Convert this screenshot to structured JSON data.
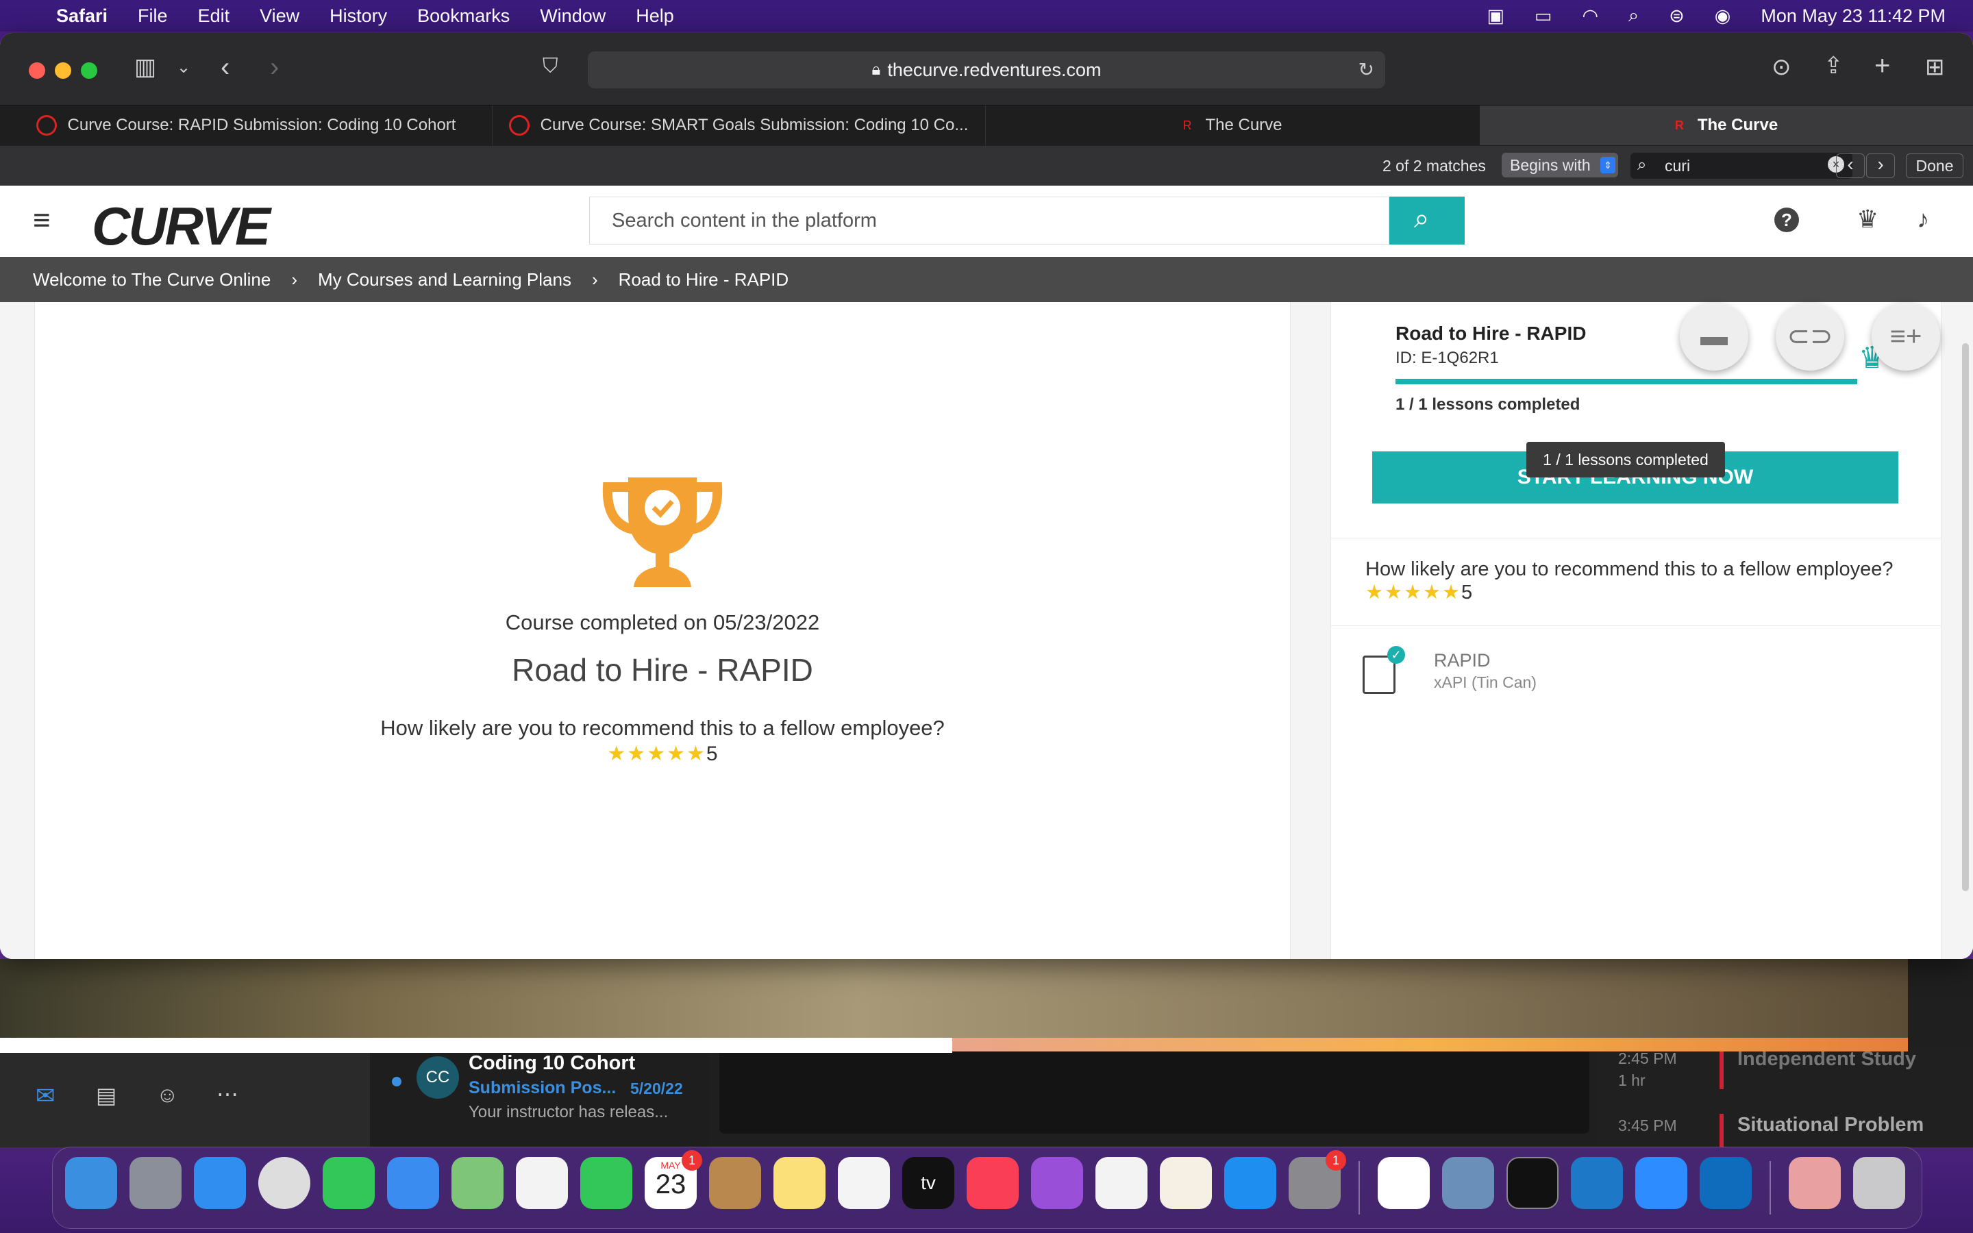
{
  "menubar": {
    "app": "Safari",
    "items": [
      "File",
      "Edit",
      "View",
      "History",
      "Bookmarks",
      "Window",
      "Help"
    ],
    "clock": "Mon May 23  11:42 PM"
  },
  "browser": {
    "url": "thecurve.redventures.com",
    "tabs": [
      {
        "label": "Curve Course: RAPID Submission: Coding 10 Cohort"
      },
      {
        "label": "Curve Course: SMART Goals Submission: Coding 10 Co..."
      },
      {
        "label": "The Curve"
      },
      {
        "label": "The Curve"
      }
    ],
    "find": {
      "matches": "2 of 2 matches",
      "mode": "Begins with",
      "query": "curi",
      "done": "Done"
    }
  },
  "site": {
    "logo": "CURVE",
    "search_placeholder": "Search content in the platform",
    "breadcrumbs": [
      "Welcome to The Curve Online",
      "My Courses and Learning Plans",
      "Road to Hire - RAPID"
    ]
  },
  "course": {
    "completed_text": "Course completed on 05/23/2022",
    "title": "Road to Hire - RAPID",
    "question": "How likely are you to recommend this to a fellow employee?",
    "stars": "★★★★★",
    "rating": "5"
  },
  "sidebar": {
    "title": "Road to Hire - RAPID",
    "id": "ID: E-1Q62R1",
    "progress_fraction": 1.0,
    "lessons": "1 / 1 lessons completed",
    "tooltip": "1 / 1 lessons completed",
    "start_button": "START LEARNING NOW",
    "question": "How likely are you to recommend this to a fellow employee?",
    "stars": "★★★★★",
    "rating": "5",
    "lesson_name": "RAPID",
    "lesson_type": "xAPI (Tin Can)"
  },
  "outlook": {
    "sender_initials": "CC",
    "sender": "Coding 10 Cohort",
    "subject": "Submission Pos...",
    "date": "5/20/22",
    "preview": "Your instructor has releas...",
    "cal_time1": "2:45 PM",
    "cal_dur1": "1 hr",
    "cal_event1": "Independent Study",
    "cal_time2": "3:45 PM",
    "cal_event2": "Situational Problem"
  },
  "dock": {
    "calendar_month": "MAY",
    "calendar_day": "23",
    "calendar_badge": "1",
    "settings_badge": "1",
    "tv_label": "tv"
  }
}
